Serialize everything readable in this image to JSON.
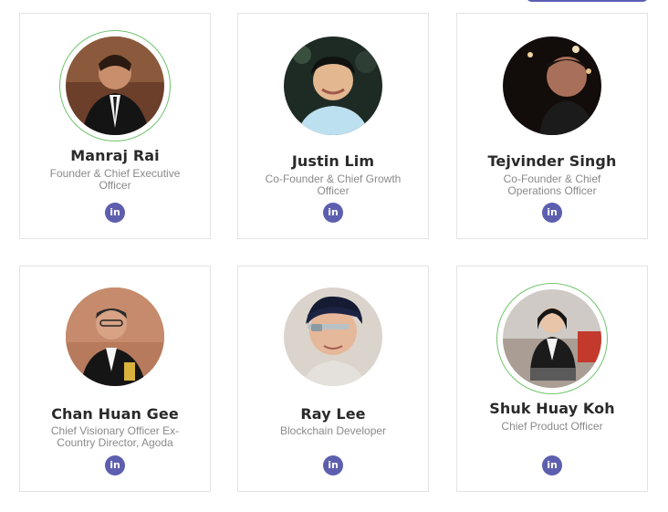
{
  "team": [
    {
      "name": "Manraj Rai",
      "role": "Founder & Chief Executive Officer",
      "linkedin_label": "in"
    },
    {
      "name": "Justin Lim",
      "role": "Co-Founder & Chief Growth Officer",
      "linkedin_label": "in"
    },
    {
      "name": "Tejvinder Singh",
      "role": "Co-Founder & Chief Operations Officer",
      "linkedin_label": "in"
    },
    {
      "name": "Chan Huan Gee",
      "role": "Chief Visionary Officer Ex-Country Director, Agoda",
      "linkedin_label": "in"
    },
    {
      "name": "Ray Lee",
      "role": "Blockchain Developer",
      "linkedin_label": "in"
    },
    {
      "name": "Shuk Huay Koh",
      "role": "Chief Product Officer",
      "linkedin_label": "in"
    }
  ],
  "colors": {
    "accent": "#5d5fae",
    "ring": "#71c46e",
    "border": "#e3e3e3"
  }
}
